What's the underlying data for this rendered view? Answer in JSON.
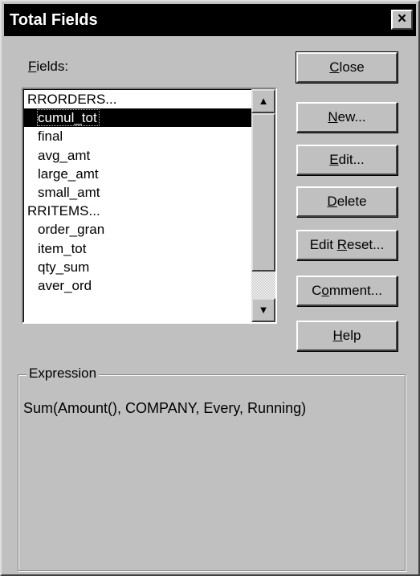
{
  "window": {
    "title": "Total Fields",
    "close_glyph": "×"
  },
  "fields": {
    "label_accel": "F",
    "label_rest": "ields:",
    "items": [
      {
        "text": "RRORDERS...",
        "child": false,
        "selected": false
      },
      {
        "text": "cumul_tot",
        "child": true,
        "selected": true
      },
      {
        "text": "final",
        "child": true,
        "selected": false
      },
      {
        "text": "avg_amt",
        "child": true,
        "selected": false
      },
      {
        "text": "large_amt",
        "child": true,
        "selected": false
      },
      {
        "text": "small_amt",
        "child": true,
        "selected": false
      },
      {
        "text": "RRITEMS...",
        "child": false,
        "selected": false
      },
      {
        "text": "order_gran",
        "child": true,
        "selected": false
      },
      {
        "text": "item_tot",
        "child": true,
        "selected": false
      },
      {
        "text": "qty_sum",
        "child": true,
        "selected": false
      },
      {
        "text": "aver_ord",
        "child": true,
        "selected": false
      }
    ],
    "scroll_up_glyph": "▲",
    "scroll_down_glyph": "▼"
  },
  "buttons": [
    {
      "name": "close-button",
      "pre": "",
      "accel": "C",
      "post": "lose",
      "default": true
    },
    {
      "name": "new-button",
      "pre": "",
      "accel": "N",
      "post": "ew...",
      "default": false
    },
    {
      "name": "edit-button",
      "pre": "",
      "accel": "E",
      "post": "dit...",
      "default": false
    },
    {
      "name": "delete-button",
      "pre": "",
      "accel": "D",
      "post": "elete",
      "default": false
    },
    {
      "name": "edit-reset-button",
      "pre": "Edit ",
      "accel": "R",
      "post": "eset...",
      "default": false
    },
    {
      "name": "comment-button",
      "pre": "C",
      "accel": "o",
      "post": "mment...",
      "default": false
    },
    {
      "name": "help-button",
      "pre": "",
      "accel": "H",
      "post": "elp",
      "default": false
    }
  ],
  "expression": {
    "label": "Expression",
    "text": "Sum(Amount(), COMPANY, Every, Running)"
  }
}
